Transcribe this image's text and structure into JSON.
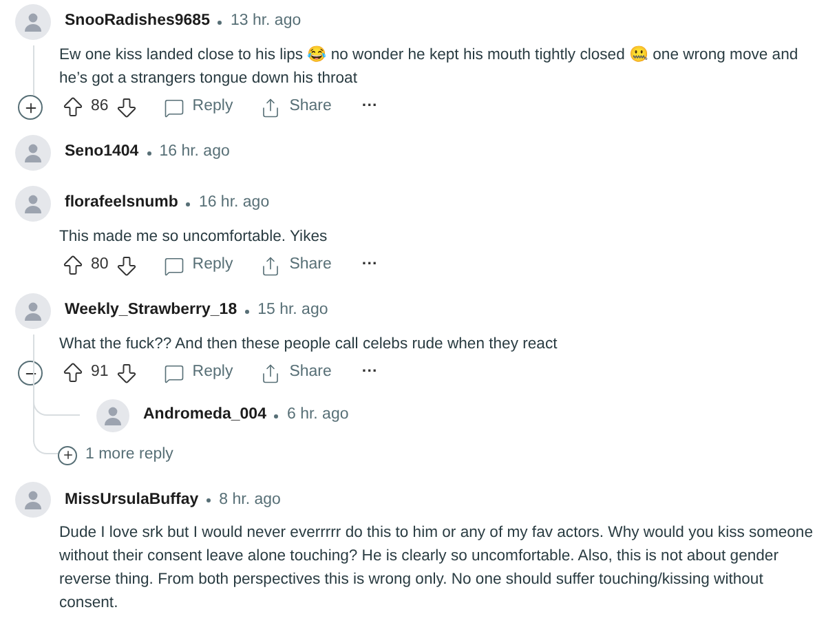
{
  "comments": [
    {
      "author": "SnooRadishes9685",
      "time": "13 hr. ago",
      "body": "Ew one kiss landed close to his lips 😂 no wonder he kept his mouth tightly closed 🤐 one wrong move and he’s got a strangers tongue down his throat",
      "thread_expanded": false,
      "votes": "86",
      "reply": "Reply",
      "share": "Share",
      "more": "···"
    },
    {
      "author": "Seno1404",
      "time": "16 hr. ago"
    },
    {
      "author": "florafeelsnumb",
      "time": "16 hr. ago",
      "body": "This made me so uncomfortable. Yikes",
      "votes": "80",
      "reply": "Reply",
      "share": "Share",
      "more": "···"
    },
    {
      "author": "Weekly_Strawberry_18",
      "time": "15 hr. ago",
      "body": "What the fuck?? And then these people call celebs rude when they react",
      "thread_expanded": true,
      "votes": "91",
      "reply": "Reply",
      "share": "Share",
      "more": "···",
      "replies": [
        {
          "author": "Andromeda_004",
          "time": "6 hr. ago"
        }
      ],
      "more_replies": "1 more reply"
    },
    {
      "author": "MissUrsulaBuffay",
      "time": "8 hr. ago",
      "body": "Dude I love srk but I would never everrrrr do this to him or any of my fav actors. Why would you kiss someone without their consent leave alone touching? He is clearly so uncomfortable. Also, this is not about gender reverse thing. From both perspectives this is wrong only. No one should suffer touching/kissing without consent."
    }
  ]
}
